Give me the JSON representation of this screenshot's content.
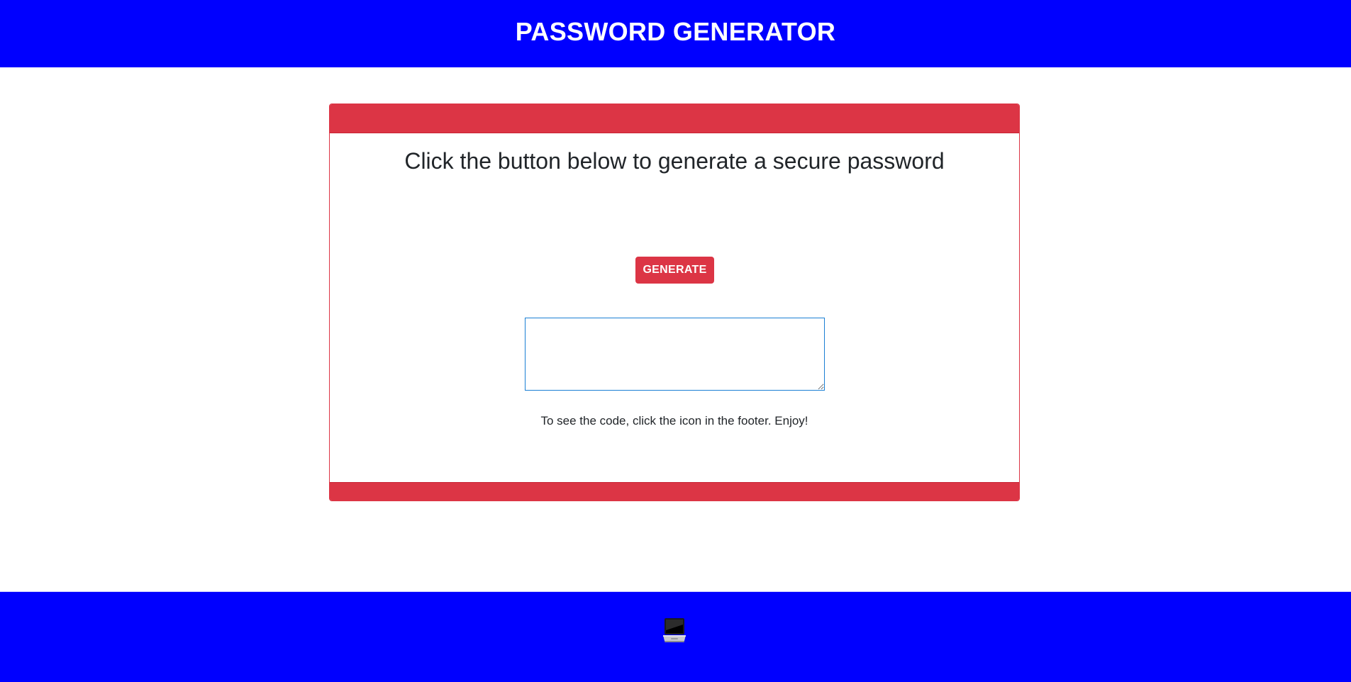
{
  "header": {
    "title": "PASSWORD GENERATOR",
    "background": "#0000ff"
  },
  "card": {
    "accent": "#dc3545",
    "title": "Click the button below to generate a secure password",
    "generate_label": "GENERATE",
    "password_value": "",
    "hint": "To see the code, click the icon in the footer. Enjoy!"
  },
  "footer": {
    "background": "#0000ff",
    "icon": "laptop-icon"
  }
}
